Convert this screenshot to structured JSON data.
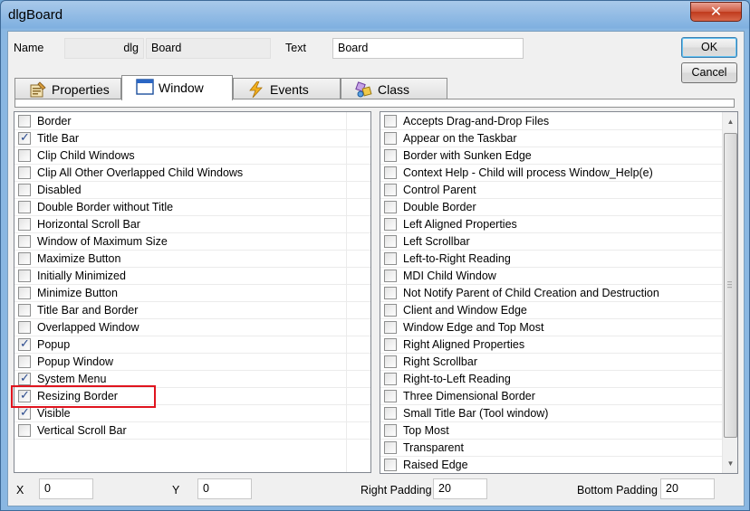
{
  "window": {
    "title": "dlgBoard",
    "close_symbol": "✕"
  },
  "header": {
    "name_label": "Name",
    "name_prefix": "dlg",
    "name_value": "Board",
    "text_label": "Text",
    "text_value": "Board"
  },
  "buttons": {
    "ok": "OK",
    "cancel": "Cancel"
  },
  "tabs": [
    {
      "label": "Properties",
      "icon": "properties-icon"
    },
    {
      "label": "Window",
      "icon": "window-icon"
    },
    {
      "label": "Events",
      "icon": "lightning-icon"
    },
    {
      "label": "Class",
      "icon": "class-icon"
    }
  ],
  "active_tab": "Window",
  "left_list": [
    {
      "label": "Border",
      "checked": false
    },
    {
      "label": "Title Bar",
      "checked": true
    },
    {
      "label": "Clip Child Windows",
      "checked": false
    },
    {
      "label": "Clip All Other Overlapped Child Windows",
      "checked": false
    },
    {
      "label": "Disabled",
      "checked": false
    },
    {
      "label": "Double Border without Title",
      "checked": false
    },
    {
      "label": "Horizontal Scroll Bar",
      "checked": false
    },
    {
      "label": "Window of Maximum Size",
      "checked": false
    },
    {
      "label": "Maximize Button",
      "checked": false
    },
    {
      "label": "Initially Minimized",
      "checked": false
    },
    {
      "label": "Minimize Button",
      "checked": false
    },
    {
      "label": "Title Bar and Border",
      "checked": false
    },
    {
      "label": "Overlapped Window",
      "checked": false
    },
    {
      "label": "Popup",
      "checked": true
    },
    {
      "label": "Popup Window",
      "checked": false
    },
    {
      "label": "System Menu",
      "checked": true
    },
    {
      "label": "Resizing Border",
      "checked": true
    },
    {
      "label": "Visible",
      "checked": true
    },
    {
      "label": "Vertical Scroll Bar",
      "checked": false
    }
  ],
  "right_list": [
    {
      "label": "Accepts Drag-and-Drop Files",
      "checked": false
    },
    {
      "label": "Appear on the Taskbar",
      "checked": false
    },
    {
      "label": "Border with Sunken Edge",
      "checked": false
    },
    {
      "label": "Context Help - Child will process Window_Help(e)",
      "checked": false
    },
    {
      "label": "Control Parent",
      "checked": false
    },
    {
      "label": "Double Border",
      "checked": false
    },
    {
      "label": "Left Aligned Properties",
      "checked": false
    },
    {
      "label": "Left Scrollbar",
      "checked": false
    },
    {
      "label": "Left-to-Right Reading",
      "checked": false
    },
    {
      "label": "MDI Child Window",
      "checked": false
    },
    {
      "label": "Not Notify Parent of Child Creation and Destruction",
      "checked": false
    },
    {
      "label": "Client and Window Edge",
      "checked": false
    },
    {
      "label": "Window Edge and Top Most",
      "checked": false
    },
    {
      "label": "Right Aligned Properties",
      "checked": false
    },
    {
      "label": "Right Scrollbar",
      "checked": false
    },
    {
      "label": "Right-to-Left Reading",
      "checked": false
    },
    {
      "label": "Three Dimensional Border",
      "checked": false
    },
    {
      "label": "Small Title Bar (Tool window)",
      "checked": false
    },
    {
      "label": "Top Most",
      "checked": false
    },
    {
      "label": "Transparent",
      "checked": false
    },
    {
      "label": "Raised Edge",
      "checked": false
    }
  ],
  "footer": {
    "x_label": "X",
    "x_value": "0",
    "y_label": "Y",
    "y_value": "0",
    "right_padding_label": "Right Padding",
    "right_padding_value": "20",
    "bottom_padding_label": "Bottom Padding",
    "bottom_padding_value": "20"
  },
  "colors": {
    "highlight": "#e0141e",
    "check": "#2b4b8e"
  }
}
